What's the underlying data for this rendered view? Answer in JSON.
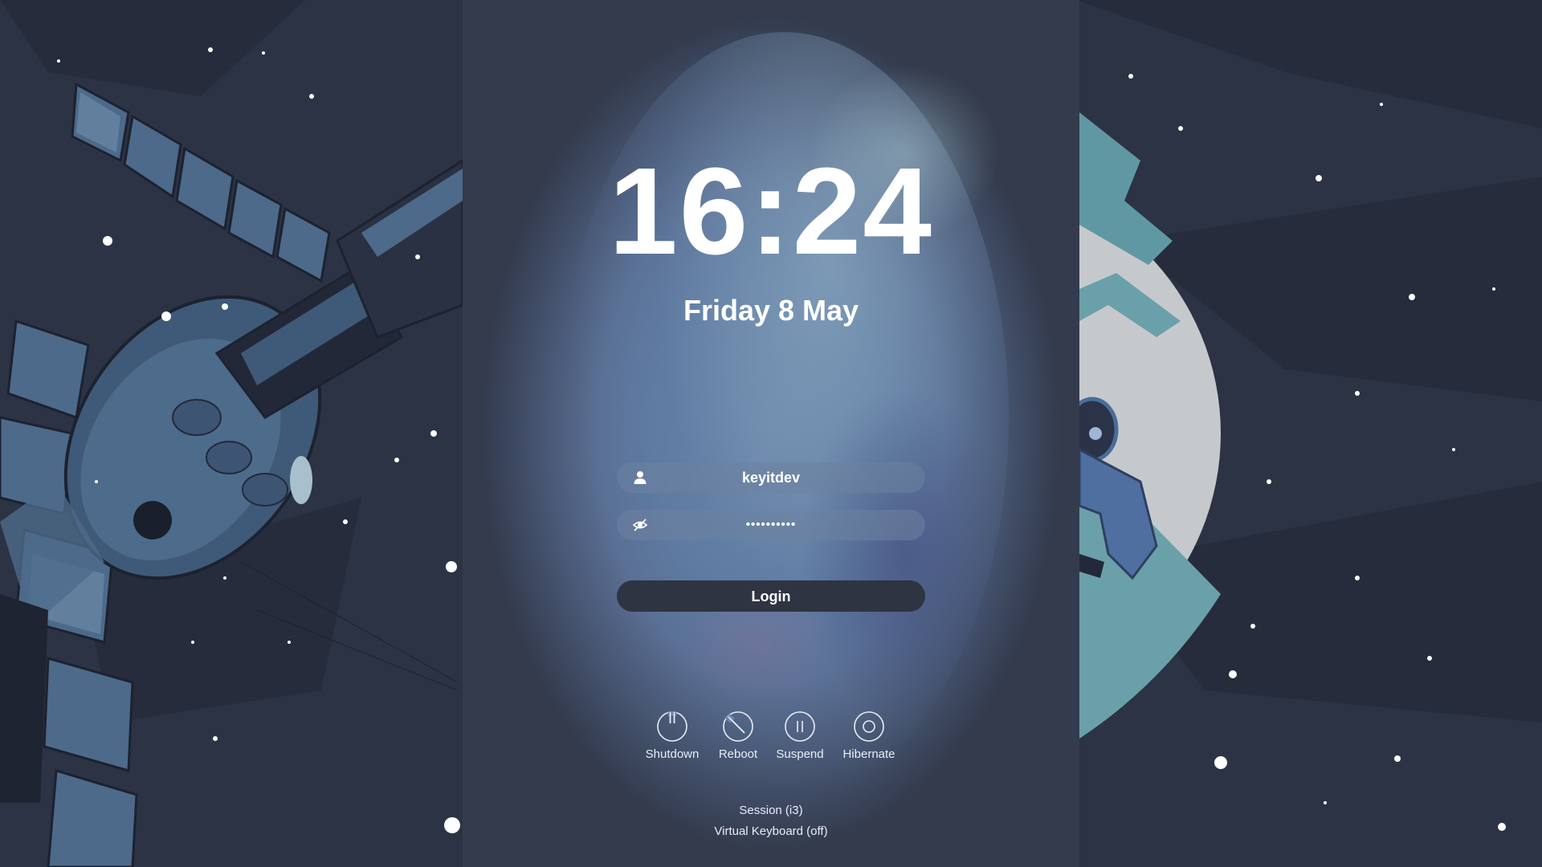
{
  "clock": {
    "time": "16:24",
    "date": "Friday 8 May"
  },
  "login": {
    "username": "keyitdev",
    "password_masked": "••••••••••",
    "user_icon": "user-icon",
    "password_icon": "eye-slash-icon",
    "button_label": "Login"
  },
  "power": [
    {
      "label": "Shutdown",
      "icon": "power-icon"
    },
    {
      "label": "Reboot",
      "icon": "reboot-icon"
    },
    {
      "label": "Suspend",
      "icon": "pause-icon"
    },
    {
      "label": "Hibernate",
      "icon": "hibernate-icon"
    }
  ],
  "footer": {
    "session": "Session (i3)",
    "virtual_keyboard": "Virtual Keyboard (off)"
  },
  "colors": {
    "background": "#2c3344",
    "panel": "#5d7aa0",
    "field": "#7388a8",
    "button": "#2f3443",
    "text": "#ffffff"
  }
}
